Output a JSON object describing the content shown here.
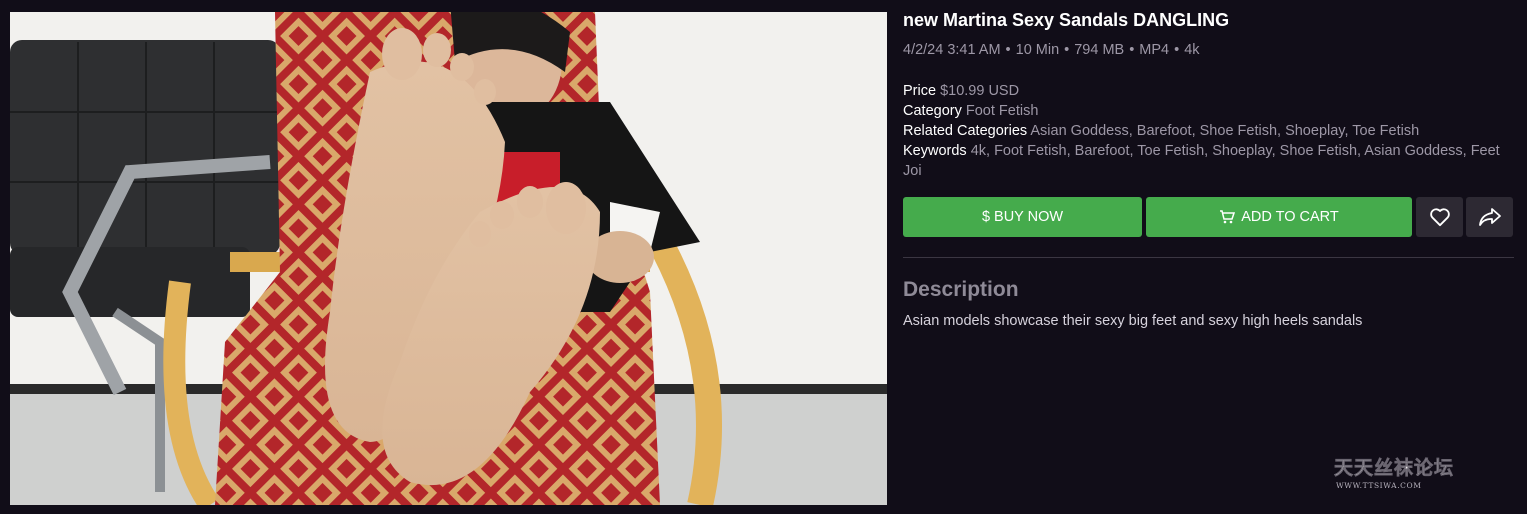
{
  "product": {
    "title": "new Martina Sexy Sandals DANGLING",
    "meta": {
      "date": "4/2/24 3:41 AM",
      "duration": "10 Min",
      "size": "794 MB",
      "format": "MP4",
      "quality": "4k",
      "separator": "•"
    },
    "price": {
      "label": "Price",
      "value": "$10.99 USD"
    },
    "category": {
      "label": "Category",
      "value": "Foot Fetish"
    },
    "related": {
      "label": "Related Categories",
      "value": "Asian Goddess, Barefoot, Shoe Fetish, Shoeplay, Toe Fetish"
    },
    "keywords": {
      "label": "Keywords",
      "value": "4k, Foot Fetish, Barefoot, Toe Fetish, Shoeplay, Shoe Fetish, Asian Goddess, Feet Joi"
    }
  },
  "actions": {
    "buy_now": "$ BUY NOW",
    "add_to_cart": "ADD TO CART",
    "favorite_icon": "heart-icon",
    "share_icon": "share-icon"
  },
  "description": {
    "heading": "Description",
    "text": "Asian models showcase their sexy big feet and sexy high heels sandals"
  },
  "watermark": {
    "text": "天天丝袜论坛",
    "url": "WWW.TTSIWA.COM"
  },
  "colors": {
    "background": "#110d18",
    "accent_green": "#45ab4c",
    "muted_text": "#9d97a6",
    "icon_button": "#2d2933"
  }
}
